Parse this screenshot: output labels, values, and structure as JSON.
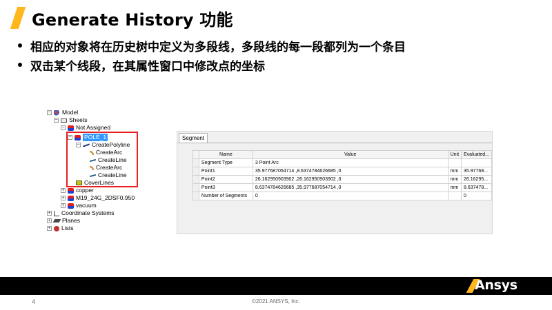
{
  "slide": {
    "title": "Generate History 功能",
    "bullets": [
      "相应的对象将在历史树中定义为多段线，多段线的每一段都列为一个条目",
      "双击某个线段，在其属性窗口中修改点的坐标"
    ],
    "page_number": "4",
    "copyright": "©2021 ANSYS, Inc.",
    "logo_text": "Ansys",
    "accent_color": "#ffb71b"
  },
  "tree": {
    "nodes": [
      {
        "label": "Model",
        "icon": "model-icon",
        "toggle": "⊟"
      },
      {
        "label": "Sheets",
        "icon": "sheets-icon",
        "toggle": "⊟"
      },
      {
        "label": "Not Assigned",
        "icon": "body-icon",
        "toggle": "⊟"
      },
      {
        "label": "POLE_1",
        "icon": "body-icon",
        "toggle": "⊟",
        "selected": true
      },
      {
        "label": "CreatePolyline",
        "icon": "polyline-icon",
        "toggle": "⊟"
      },
      {
        "label": "CreateArc",
        "icon": "arc-icon"
      },
      {
        "label": "CreateLine",
        "icon": "line-icon"
      },
      {
        "label": "CreateArc",
        "icon": "arc-icon"
      },
      {
        "label": "CreateLine",
        "icon": "line-icon"
      },
      {
        "label": "CoverLines",
        "icon": "cover-icon"
      },
      {
        "label": "copper",
        "icon": "body-icon",
        "toggle": "⊞"
      },
      {
        "label": "M19_24G_2DSF0.950",
        "icon": "body-icon",
        "toggle": "⊞"
      },
      {
        "label": "vacuum",
        "icon": "body-icon",
        "toggle": "⊞"
      },
      {
        "label": "Coordinate Systems",
        "icon": "coordinate-icon",
        "toggle": "⊞"
      },
      {
        "label": "Planes",
        "icon": "planes-icon",
        "toggle": "⊞"
      },
      {
        "label": "Lists",
        "icon": "lists-icon",
        "toggle": "⊞"
      }
    ]
  },
  "segment_panel": {
    "tab_label": "Segment",
    "columns": [
      "Name",
      "Value",
      "Unit",
      "Evaluated..."
    ],
    "rows": [
      [
        "Segment Type",
        "3 Point Arc",
        "",
        ""
      ],
      [
        "Point1",
        "35.977687054714 ,8.6374784626685 ,0",
        "mm",
        "35.97768..."
      ],
      [
        "Point2",
        "26.162950903902 ,26.162950903902 ,0",
        "mm",
        "26.16295..."
      ],
      [
        "Point3",
        "8.6374784626685 ,35.977687054714 ,0",
        "mm",
        "8.637478..."
      ],
      [
        "Number of Segments",
        "0",
        "",
        "0"
      ]
    ]
  }
}
